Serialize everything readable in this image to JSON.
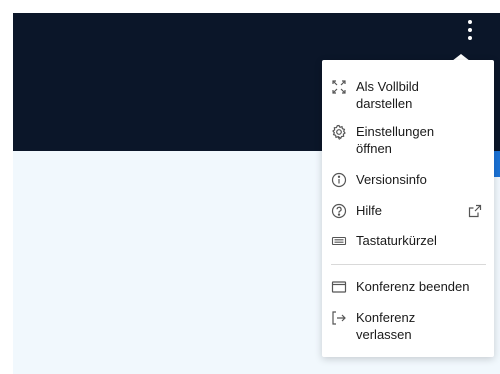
{
  "header": {
    "background_color": "#0b1629",
    "more_icon": "kebab-vertical-icon"
  },
  "menu": {
    "items": [
      {
        "label": "Als Vollbild\ndarstellen",
        "icon": "fullscreen-icon"
      },
      {
        "label": "Einstellungen\nöffnen",
        "icon": "gear-icon"
      },
      {
        "label": "Versionsinfo",
        "icon": "info-icon"
      },
      {
        "label": "Hilfe",
        "icon": "help-icon",
        "trailing_icon": "external-link-icon"
      },
      {
        "label": "Tastaturkürzel",
        "icon": "keyboard-icon"
      },
      {
        "label": "Konferenz beenden",
        "icon": "window-icon"
      },
      {
        "label": "Konferenz\nverlassen",
        "icon": "exit-icon"
      }
    ]
  },
  "colors": {
    "page_background": "#f1f8fd",
    "accent_blue": "#1a72d6"
  }
}
